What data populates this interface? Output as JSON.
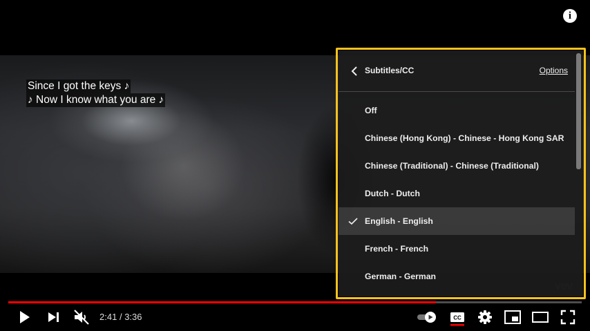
{
  "player": {
    "watermark": "vev",
    "captions": [
      "Since I got the keys ♪",
      "♪ Now I know what you are ♪"
    ],
    "progress_fraction": 0.7463
  },
  "settings": {
    "title": "Subtitles/CC",
    "options_label": "Options",
    "selected_index": 4,
    "items": [
      {
        "label": "Off"
      },
      {
        "label": "Chinese (Hong Kong) - Chinese - Hong Kong SAR"
      },
      {
        "label": "Chinese (Traditional) - Chinese (Traditional)"
      },
      {
        "label": "Dutch - Dutch"
      },
      {
        "label": "English - English"
      },
      {
        "label": "French - French"
      },
      {
        "label": "German - German"
      }
    ]
  },
  "controls": {
    "current_time": "2:41",
    "separator": "/",
    "duration": "3:36",
    "cc_label": "CC",
    "accent_color": "#ff0000",
    "highlight_color": "#f7c31e"
  },
  "icons": {
    "info": "info-icon",
    "play": "play-icon",
    "next": "next-icon",
    "mute": "volume-muted-icon",
    "autoplay": "autoplay-toggle-icon",
    "cc": "closed-captions-icon",
    "settings": "gear-icon",
    "miniplayer": "miniplayer-icon",
    "theater": "theater-mode-icon",
    "fullscreen": "fullscreen-icon",
    "back": "chevron-left-icon",
    "check": "checkmark-icon"
  }
}
